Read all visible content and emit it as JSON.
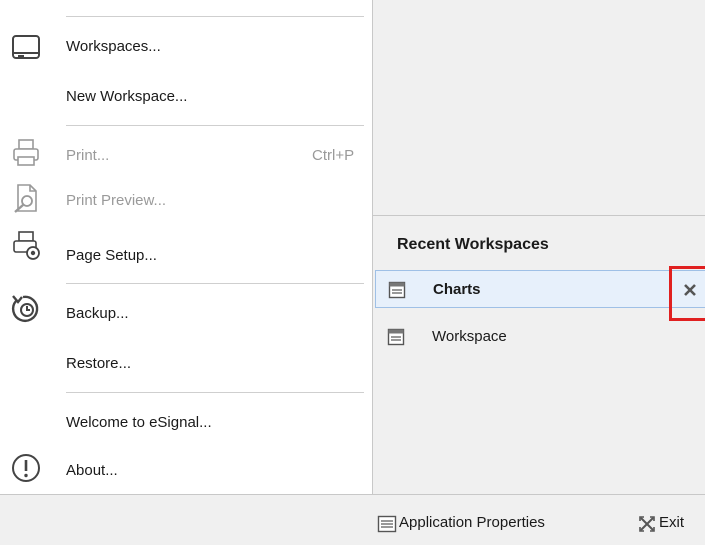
{
  "menu": {
    "workspaces": {
      "label": "Workspaces...",
      "icon": "workspace-window-icon"
    },
    "new_workspace": {
      "label": "New Workspace..."
    },
    "print": {
      "label": "Print...",
      "shortcut": "Ctrl+P",
      "icon": "printer-icon",
      "enabled": false
    },
    "print_preview": {
      "label": "Print Preview...",
      "icon": "print-preview-icon",
      "enabled": false
    },
    "page_setup": {
      "label": "Page Setup...",
      "icon": "page-setup-icon"
    },
    "backup": {
      "label": "Backup...",
      "icon": "backup-icon"
    },
    "restore": {
      "label": "Restore..."
    },
    "welcome": {
      "label": "Welcome to eSignal..."
    },
    "about": {
      "label": "About...",
      "icon": "info-exclamation-icon"
    }
  },
  "recent": {
    "title": "Recent Workspaces",
    "items": [
      {
        "label": "Charts",
        "selected": true,
        "icon": "workspace-grid-icon"
      },
      {
        "label": "Workspace",
        "selected": false,
        "icon": "workspace-grid-icon"
      }
    ],
    "remove_icon": "close-x-icon",
    "highlight_color": "#e02020"
  },
  "bottom_bar": {
    "app_properties": {
      "label": "Application Properties",
      "icon": "properties-list-icon"
    },
    "exit": {
      "label": "Exit",
      "icon": "exit-icon"
    }
  }
}
